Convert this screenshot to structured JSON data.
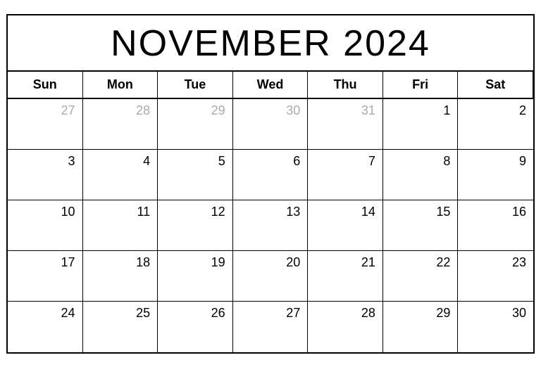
{
  "calendar": {
    "title": "NOVEMBER 2024",
    "headers": [
      "Sun",
      "Mon",
      "Tue",
      "Wed",
      "Thu",
      "Fri",
      "Sat"
    ],
    "weeks": [
      [
        {
          "day": "27",
          "outside": true
        },
        {
          "day": "28",
          "outside": true
        },
        {
          "day": "29",
          "outside": true
        },
        {
          "day": "30",
          "outside": true
        },
        {
          "day": "31",
          "outside": true
        },
        {
          "day": "1",
          "outside": false
        },
        {
          "day": "2",
          "outside": false
        }
      ],
      [
        {
          "day": "3",
          "outside": false
        },
        {
          "day": "4",
          "outside": false
        },
        {
          "day": "5",
          "outside": false
        },
        {
          "day": "6",
          "outside": false
        },
        {
          "day": "7",
          "outside": false
        },
        {
          "day": "8",
          "outside": false
        },
        {
          "day": "9",
          "outside": false
        }
      ],
      [
        {
          "day": "10",
          "outside": false
        },
        {
          "day": "11",
          "outside": false
        },
        {
          "day": "12",
          "outside": false
        },
        {
          "day": "13",
          "outside": false
        },
        {
          "day": "14",
          "outside": false
        },
        {
          "day": "15",
          "outside": false
        },
        {
          "day": "16",
          "outside": false
        }
      ],
      [
        {
          "day": "17",
          "outside": false
        },
        {
          "day": "18",
          "outside": false
        },
        {
          "day": "19",
          "outside": false
        },
        {
          "day": "20",
          "outside": false
        },
        {
          "day": "21",
          "outside": false
        },
        {
          "day": "22",
          "outside": false
        },
        {
          "day": "23",
          "outside": false
        }
      ],
      [
        {
          "day": "24",
          "outside": false
        },
        {
          "day": "25",
          "outside": false
        },
        {
          "day": "26",
          "outside": false
        },
        {
          "day": "27",
          "outside": false
        },
        {
          "day": "28",
          "outside": false
        },
        {
          "day": "29",
          "outside": false
        },
        {
          "day": "30",
          "outside": false
        }
      ]
    ]
  }
}
